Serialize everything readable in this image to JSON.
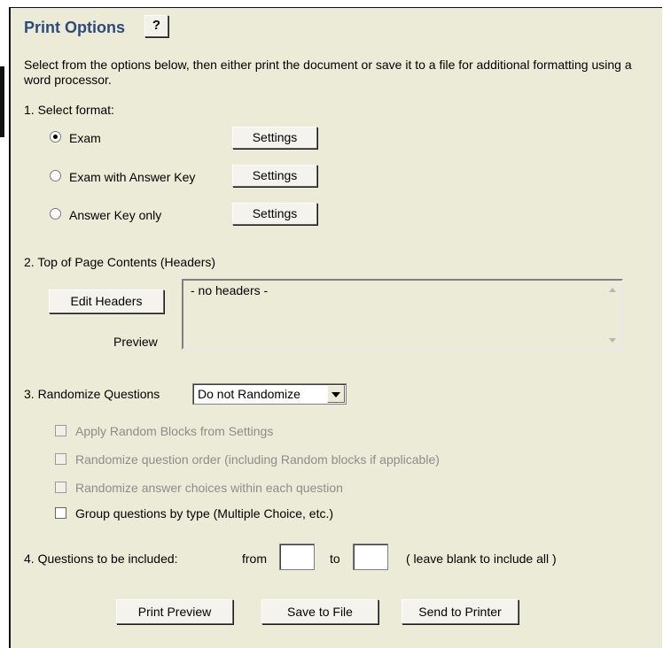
{
  "header": {
    "title": "Print Options",
    "help_label": "?"
  },
  "intro": "Select from the options below, then either print the document or save it to a file for additional formatting using a word processor.",
  "format": {
    "label": "1.  Select format:",
    "options": [
      {
        "label": "Exam",
        "selected": true,
        "settings_label": "Settings"
      },
      {
        "label": "Exam with Answer Key",
        "selected": false,
        "settings_label": "Settings"
      },
      {
        "label": "Answer Key only",
        "selected": false,
        "settings_label": "Settings"
      }
    ]
  },
  "headers": {
    "label": "2.  Top of Page Contents (Headers)",
    "edit_label": "Edit Headers",
    "preview_label": "Preview",
    "preview_text": "- no headers -"
  },
  "randomize": {
    "label": "3.  Randomize Questions",
    "selected": "Do not Randomize",
    "options": [
      {
        "label": "Apply Random Blocks from Settings",
        "checked": false,
        "enabled": false
      },
      {
        "label": "Randomize question order (including Random blocks if applicable)",
        "checked": false,
        "enabled": false
      },
      {
        "label": "Randomize answer choices within each question",
        "checked": false,
        "enabled": false
      },
      {
        "label": "Group questions by type (Multiple Choice, etc.)",
        "checked": false,
        "enabled": true
      }
    ]
  },
  "questions": {
    "label": "4.  Questions to be included:",
    "from_label": "from",
    "from_value": "",
    "to_label": "to",
    "to_value": "",
    "hint": "( leave blank to include all )"
  },
  "actions": {
    "preview_label": "Print Preview",
    "save_label": "Save to File",
    "print_label": "Send to Printer"
  }
}
